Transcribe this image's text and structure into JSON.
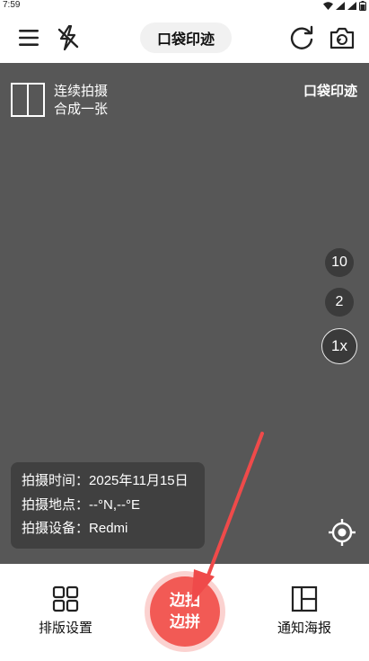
{
  "status_bar": {
    "time": "7:59"
  },
  "header": {
    "title": "口袋印迹"
  },
  "viewfinder": {
    "mode": {
      "line1": "连续拍摄",
      "line2": "合成一张"
    },
    "watermark": "口袋印迹",
    "zoom_options": [
      "10",
      "2",
      "1x"
    ],
    "info": {
      "time_label": "拍摄时间：",
      "time_value": "2025年11月15日",
      "location_label": "拍摄地点：",
      "location_value": "--°N,--°E",
      "device_label": "拍摄设备：",
      "device_value": "Redmi"
    }
  },
  "bottom_bar": {
    "layout_label": "排版设置",
    "shutter_line1": "边拍",
    "shutter_line2": "边拼",
    "poster_label": "通知海报"
  },
  "colors": {
    "accent": "#f25a55",
    "viewfinder_bg": "#575757",
    "arrow": "#ef4a4a"
  }
}
